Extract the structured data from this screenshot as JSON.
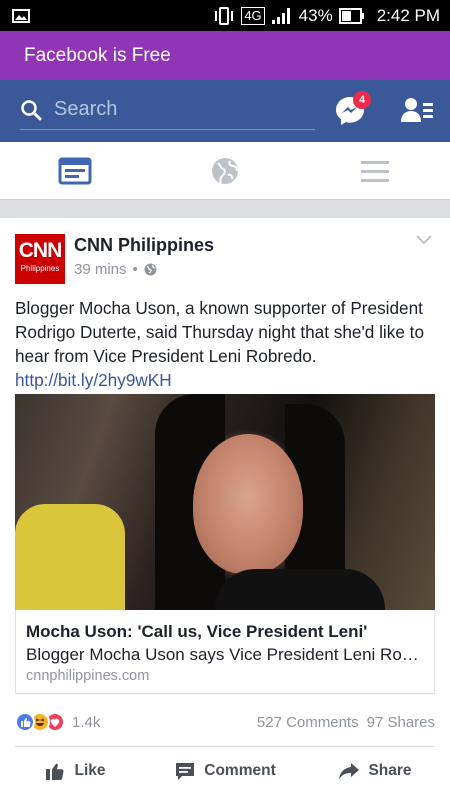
{
  "status_bar": {
    "network": "4G",
    "battery": "43%",
    "time": "2:42 PM"
  },
  "promo": {
    "text": "Facebook is Free",
    "color": "#8f35b6"
  },
  "header": {
    "search_placeholder": "Search",
    "messages_badge": "4",
    "brand_color": "#3b5998"
  },
  "tabs": [
    {
      "name": "news-feed",
      "icon": "news-feed-icon",
      "active": true
    },
    {
      "name": "notifications",
      "icon": "globe-icon",
      "active": false
    },
    {
      "name": "menu",
      "icon": "hamburger-icon",
      "active": false
    }
  ],
  "post": {
    "page_name": "CNN Philippines",
    "logo_big": "CNN",
    "logo_small": "Philippines",
    "time": "39 mins",
    "separator": "•",
    "text": "Blogger Mocha Uson, a known supporter of President Rodrigo Duterte, said Thursday night that she'd like to hear from Vice President Leni Robredo. ",
    "link": "http://bit.ly/2hy9wKH",
    "link_preview": {
      "title": "Mocha Uson: 'Call us, Vice President Leni'",
      "description": "Blogger Mocha Uson says Vice President Leni Robredo should call them",
      "domain": "cnnphilippines.com"
    },
    "reactions": [
      "like",
      "haha",
      "love"
    ],
    "reaction_count": "1.4k",
    "comments": "527 Comments",
    "shares": "97 Shares"
  },
  "actions": {
    "like": "Like",
    "comment": "Comment",
    "share": "Share"
  }
}
